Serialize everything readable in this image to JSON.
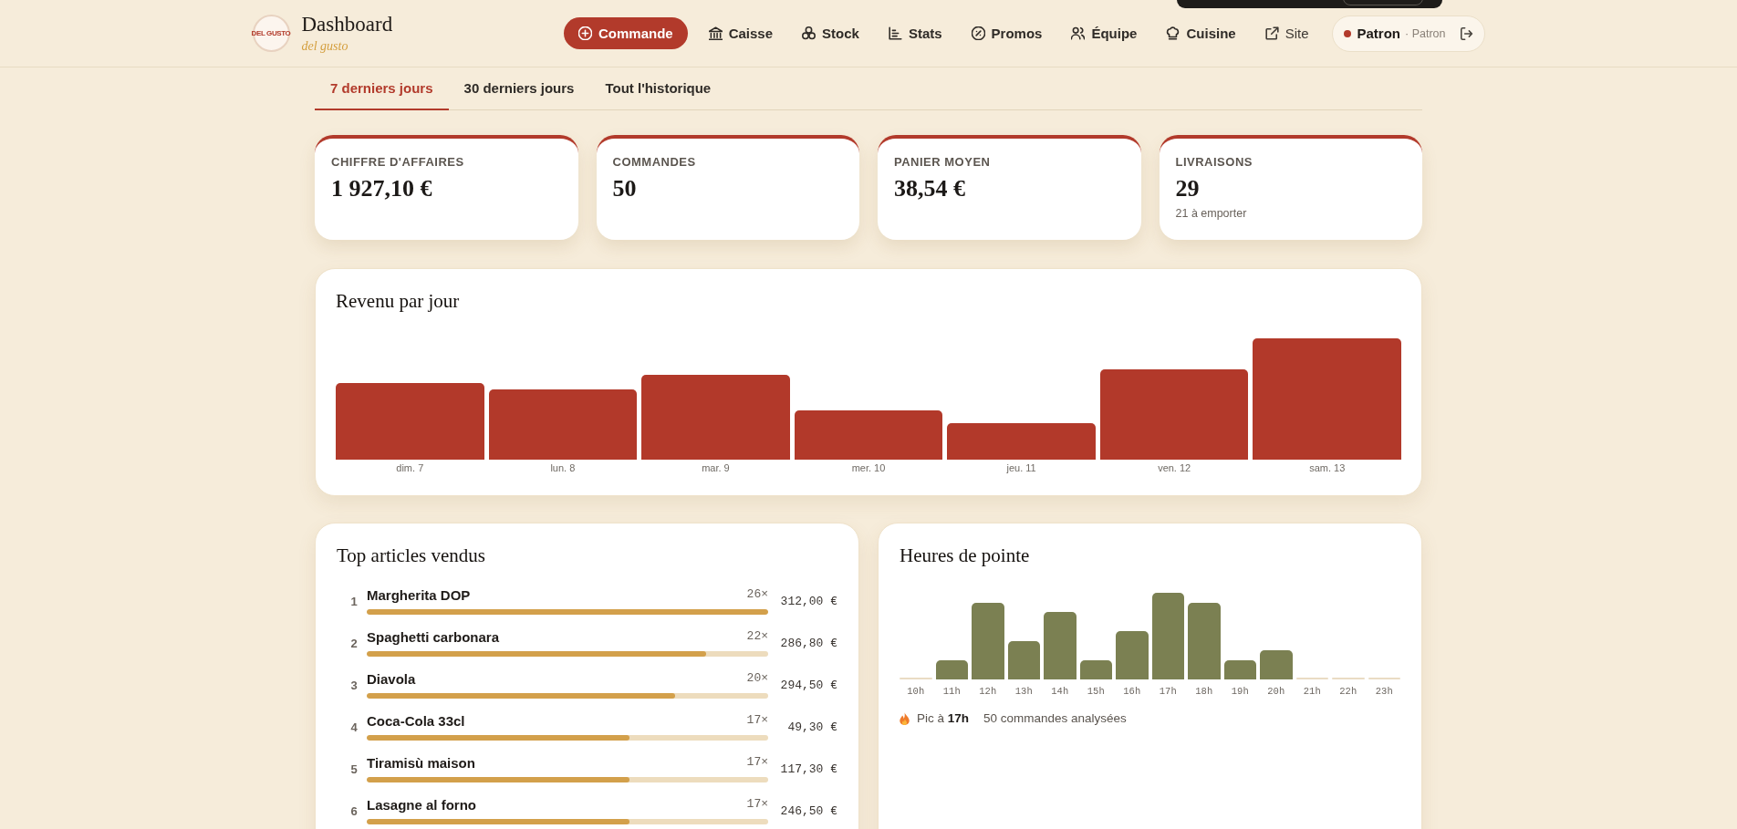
{
  "header": {
    "logo_text": "DEL GUSTO",
    "title": "Dashboard",
    "subtitle": "del gusto"
  },
  "nav": [
    {
      "kind": "primary",
      "label": "Commande"
    },
    {
      "kind": "page",
      "label": "Caisse"
    },
    {
      "kind": "page",
      "label": "Stock"
    },
    {
      "kind": "page",
      "label": "Stats"
    },
    {
      "kind": "page",
      "label": "Promos"
    },
    {
      "kind": "page",
      "label": "Équipe"
    },
    {
      "kind": "page",
      "label": "Cuisine"
    },
    {
      "kind": "external",
      "label": "Site"
    }
  ],
  "user": {
    "name": "Patron",
    "role": "· Patron"
  },
  "tabs": [
    {
      "label": "7 derniers jours",
      "selected": true
    },
    {
      "label": "30 derniers jours",
      "selected": false
    },
    {
      "label": "Tout l'historique",
      "selected": false
    }
  ],
  "kpis": [
    {
      "label": "CHIFFRE D'AFFAIRES",
      "value": "1 927,10 €"
    },
    {
      "label": "COMMANDES",
      "value": "50"
    },
    {
      "label": "PANIER MOYEN",
      "value": "38,54 €"
    },
    {
      "label": "LIVRAISONS",
      "value": "29",
      "note": "21 à emporter"
    }
  ],
  "revenue": {
    "title": "Revenu par jour",
    "days": [
      "dim. 7",
      "lun. 8",
      "mar. 9",
      "mer. 10",
      "jeu. 11",
      "ven. 12",
      "sam. 13"
    ]
  },
  "top_items": {
    "title": "Top articles vendus",
    "rows": [
      {
        "rank": "1",
        "name": "Margherita DOP",
        "count": "26×",
        "level": 1,
        "amount": "312,00 €"
      },
      {
        "rank": "2",
        "name": "Spaghetti carbonara",
        "count": "22×",
        "level": 0.846,
        "amount": "286,80 €"
      },
      {
        "rank": "3",
        "name": "Diavola",
        "count": "20×",
        "level": 0.769,
        "amount": "294,50 €"
      },
      {
        "rank": "4",
        "name": "Coca-Cola 33cl",
        "count": "17×",
        "level": 0.654,
        "amount": "49,30 €"
      },
      {
        "rank": "5",
        "name": "Tiramisù maison",
        "count": "17×",
        "level": 0.654,
        "amount": "117,30 €"
      },
      {
        "rank": "6",
        "name": "Lasagne al forno",
        "count": "17×",
        "level": 0.654,
        "amount": "246,50 €"
      }
    ]
  },
  "peak_hours": {
    "title": "Heures de pointe",
    "hours": [
      "10h",
      "11h",
      "12h",
      "13h",
      "14h",
      "15h",
      "16h",
      "17h",
      "18h",
      "19h",
      "20h",
      "21h",
      "22h",
      "23h"
    ],
    "peak": "Pic à **17h**",
    "orders": "50 commandes analysées"
  }
}
